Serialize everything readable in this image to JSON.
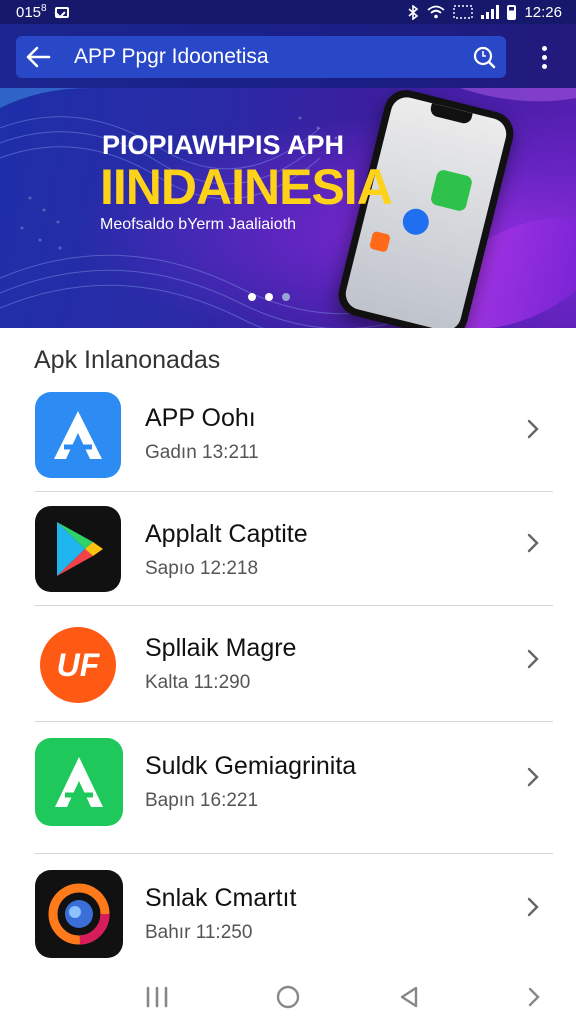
{
  "status_bar": {
    "left_text": "015",
    "left_superscript": "8",
    "time": "12:26"
  },
  "app_bar": {
    "title": "APP Ppgr Idoonetisa",
    "back_icon": "arrow-left-icon",
    "search_icon": "search-icon",
    "more_icon": "more-vert-icon"
  },
  "banner": {
    "line1": "PIOPIAWHPIS APH",
    "line2": "IINDAINESIA",
    "line3": "Meofsaldo bYerm Jaaliaioth",
    "slides_total": 3,
    "slide_active": 2,
    "colors": {
      "headline": "#ffd21a",
      "dot_active": "#ffffff",
      "dot_inactive": "#9aa3d6"
    }
  },
  "list": {
    "section_title": "Apk Inlanonadas",
    "items": [
      {
        "name": "APP Oohı",
        "meta": "Gadın 13:211",
        "icon": "a-logo-blue-icon"
      },
      {
        "name": "Applalt Captite",
        "meta": "Sapıo 12:218",
        "icon": "play-store-icon"
      },
      {
        "name": "Spllaik Magre",
        "meta": "Kalta 11:290",
        "icon": "uf-logo-icon"
      },
      {
        "name": "Suldk Gemiagrinita",
        "meta": "Bapın 16:221",
        "icon": "a-logo-green-icon"
      },
      {
        "name": "Snlak Cmartıt",
        "meta": "Bahır 11:250",
        "icon": "ring-logo-icon"
      }
    ]
  },
  "nav_bar": {
    "recents_icon": "recents-icon",
    "home_icon": "home-icon",
    "back_icon": "back-triangle-icon",
    "forward_icon": "chevron-right-icon"
  }
}
